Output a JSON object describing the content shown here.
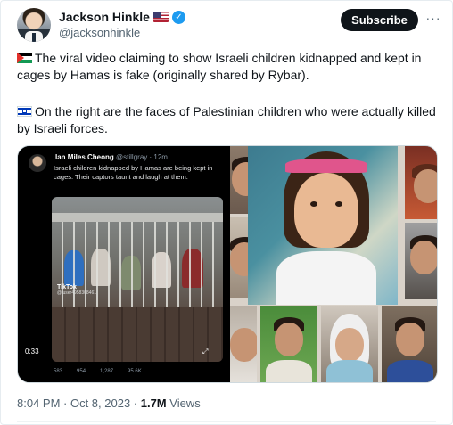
{
  "author": {
    "display_name": "Jackson Hinkle",
    "handle": "@jacksonhinkle"
  },
  "actions": {
    "subscribe_label": "Subscribe",
    "more_label": "···"
  },
  "tweet": {
    "paragraph_1": "The viral video claiming to show Israeli children kidnapped and kept in cages by Hamas is fake (originally shared by Rybar).",
    "paragraph_2": "On the right are the faces of Palestinian children who were actually killed by Israeli forces."
  },
  "embedded_post": {
    "author_name": "Ian Miles Cheong",
    "author_meta": "@stillgray · 12m",
    "text": "Israeli children kidnapped by Hamas are being kept in cages. Their captors taunt and laugh at them.",
    "video_watermark": "TikTok",
    "video_watermark_user": "@ user4958308461",
    "video_time": "0:33",
    "stats": [
      "583",
      "954",
      "1,287",
      "95.6K"
    ]
  },
  "footer": {
    "time": "8:04 PM · Oct 8, 2023 · ",
    "views_count": "1.7M",
    "views_label": " Views"
  },
  "colors": {
    "accent_blue": "#1d9bf0",
    "subscribe_bg": "#0f1419",
    "secondary_text": "#536471"
  },
  "icons": [
    "us-flag-icon",
    "verified-badge-icon",
    "palestine-flag-icon",
    "israel-flag-icon",
    "more-options-icon"
  ]
}
